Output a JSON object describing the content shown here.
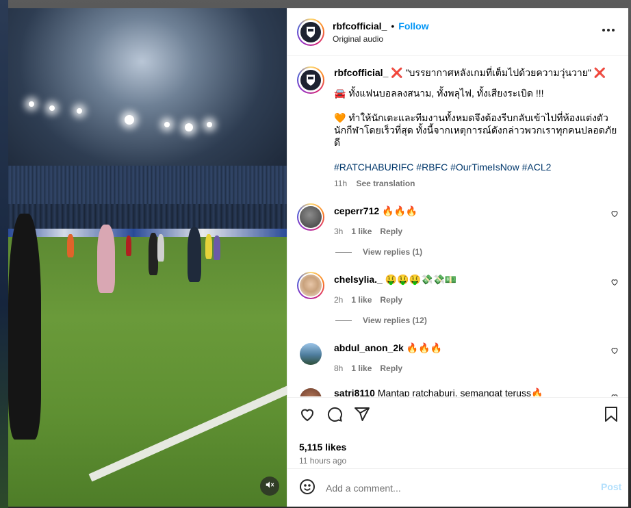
{
  "post": {
    "username": "rbfcofficial_",
    "follow_label": "Follow",
    "audio": "Original audio",
    "caption": {
      "line1": "\"บรรยากาศหลังเกมที่เต็มไปด้วยความวุ่นวาย\"",
      "mark_left": "❌",
      "mark_right": "❌",
      "line2": "🚘 ทั้งแฟนบอลลงสนาม, ทั้งพลุไฟ, ทั้งเสียงระเบิด !!!",
      "line3": "🧡 ทำให้นักเตะและทีมงานทั้งหมดจึงต้องรีบกลับเข้าไปที่ห้องแต่งตัวนักกีฬาโดยเร็วที่สุด ทั้งนี้จากเหตุการณ์ดังกล่าวพวกเราทุกคนปลอดภัยดี",
      "hashtags": "#RATCHABURIFC #RBFC #OurTimeIsNow #ACL2",
      "time": "11h",
      "see_translation": "See translation"
    }
  },
  "comments": [
    {
      "user": "ceperr712",
      "text": "🔥🔥🔥",
      "time": "3h",
      "likes": "1 like",
      "reply": "Reply",
      "replies": "View replies (1)"
    },
    {
      "user": "chelsylia._",
      "text": "🤑🤑🤑💸💸💵",
      "time": "2h",
      "likes": "1 like",
      "reply": "Reply",
      "replies": "View replies (12)"
    },
    {
      "user": "abdul_anon_2k",
      "text": "🔥🔥🔥",
      "time": "8h",
      "likes": "1 like",
      "reply": "Reply"
    },
    {
      "user": "satri8110",
      "text": "Mantap ratchaburi, semangat teruss🔥"
    }
  ],
  "footer": {
    "likes": "5,115 likes",
    "time_ago": "11 hours ago",
    "comment_placeholder": "Add a comment...",
    "post_label": "Post"
  },
  "icons": [
    "more-icon",
    "heart-icon",
    "comment-icon",
    "share-icon",
    "bookmark-icon",
    "emoji-icon",
    "mute-icon"
  ],
  "colors": {
    "link": "#0095f6",
    "hashtag": "#00376b",
    "muted": "#737373",
    "post_disabled": "#b2dffc"
  }
}
